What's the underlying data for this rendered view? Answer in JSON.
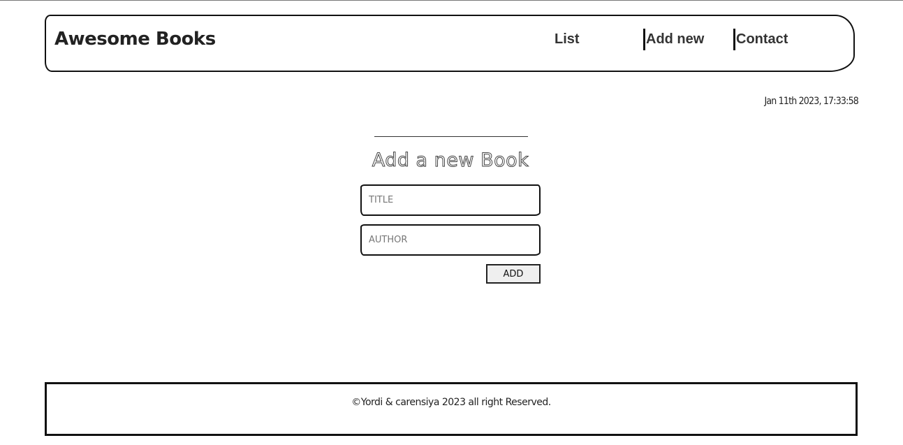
{
  "brand": {
    "name": "Awesome Books"
  },
  "nav": {
    "items": [
      {
        "label": "List"
      },
      {
        "label": "Add new"
      },
      {
        "label": "Contact"
      }
    ]
  },
  "datetime": "Jan 11th 2023, 17:33:58",
  "form": {
    "title": "Add a new Book",
    "title_input": {
      "value": "",
      "placeholder": "TITLE"
    },
    "author_input": {
      "value": "",
      "placeholder": "AUTHOR"
    },
    "submit_label": "ADD"
  },
  "footer": {
    "text": "©Yordi & carensiya 2023 all right Reserved."
  }
}
